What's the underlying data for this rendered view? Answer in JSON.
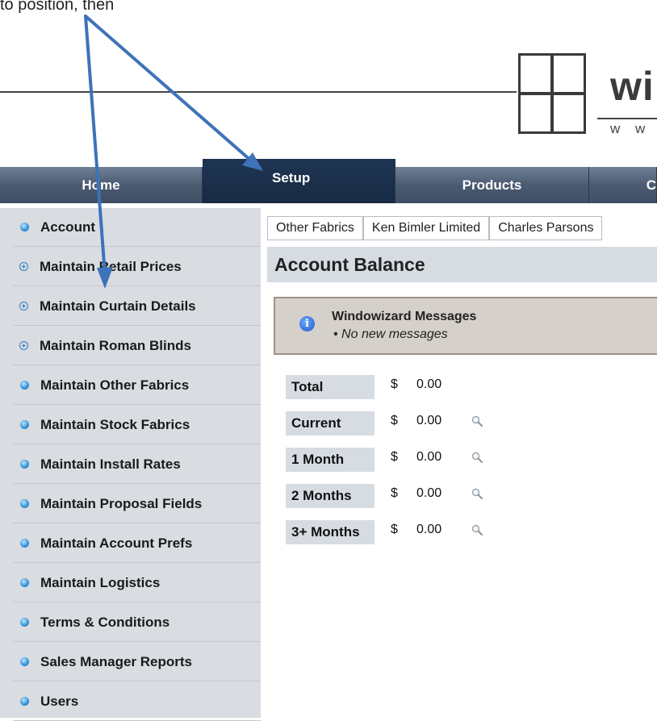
{
  "caption": "to position, then",
  "logo": {
    "text": "wi",
    "sub": "w w"
  },
  "nav": {
    "tabs": [
      {
        "label": "Home"
      },
      {
        "label": "Setup"
      },
      {
        "label": "Products"
      },
      {
        "label": "C"
      }
    ],
    "active": "Setup"
  },
  "sidebar": {
    "items": [
      {
        "label": "Account",
        "type": "bullet"
      },
      {
        "label": "Maintain Retail Prices",
        "type": "expand"
      },
      {
        "label": "Maintain Curtain Details",
        "type": "expand"
      },
      {
        "label": "Maintain Roman Blinds",
        "type": "expand"
      },
      {
        "label": "Maintain Other Fabrics",
        "type": "bullet"
      },
      {
        "label": "Maintain Stock Fabrics",
        "type": "bullet"
      },
      {
        "label": "Maintain Install Rates",
        "type": "bullet"
      },
      {
        "label": "Maintain Proposal Fields",
        "type": "bullet"
      },
      {
        "label": "Maintain Account Prefs",
        "type": "bullet"
      },
      {
        "label": "Maintain Logistics",
        "type": "bullet"
      },
      {
        "label": "Terms & Conditions",
        "type": "bullet"
      },
      {
        "label": "Sales Manager Reports",
        "type": "bullet"
      },
      {
        "label": "Users",
        "type": "bullet"
      }
    ]
  },
  "main": {
    "subtabs": [
      "Other Fabrics",
      "Ken Bimler Limited",
      "Charles Parsons"
    ],
    "title": "Account Balance",
    "messages": {
      "title": "Windowizard Messages",
      "items": [
        "No new messages"
      ]
    },
    "balances": [
      {
        "label": "Total",
        "currency": "$",
        "value": "0.00",
        "detail": false
      },
      {
        "label": "Current",
        "currency": "$",
        "value": "0.00",
        "detail": true
      },
      {
        "label": "1 Month",
        "currency": "$",
        "value": "0.00",
        "detail": true
      },
      {
        "label": "2 Months",
        "currency": "$",
        "value": "0.00",
        "detail": true
      },
      {
        "label": "3+ Months",
        "currency": "$",
        "value": "0.00",
        "detail": true
      }
    ]
  },
  "colors": {
    "nav_active": "#1f3552",
    "sidebar_bg": "#d9dce1",
    "arrow": "#3d73b8"
  }
}
